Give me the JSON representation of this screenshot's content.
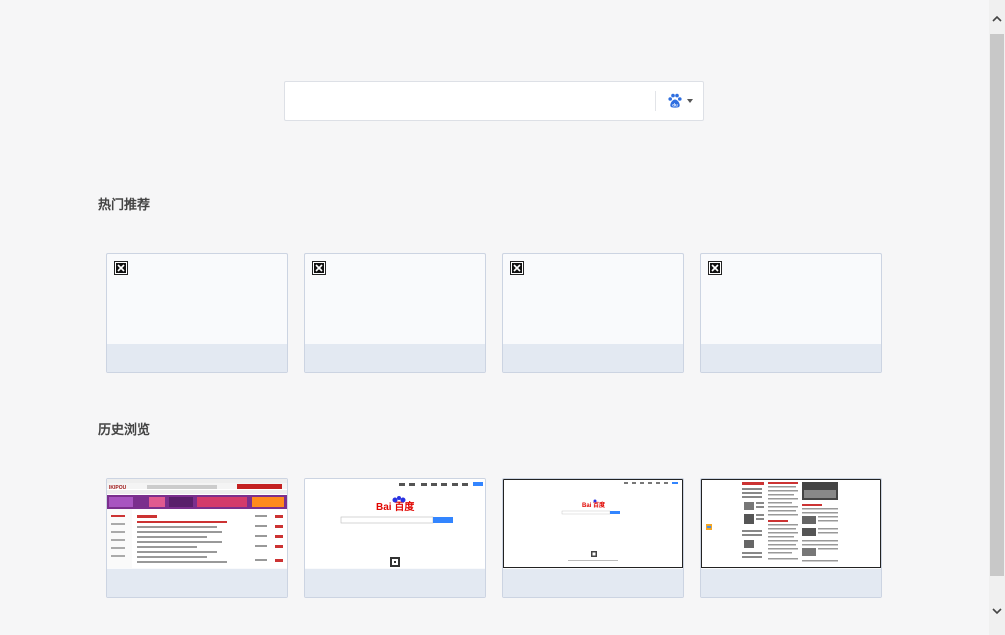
{
  "search": {
    "placeholder": "",
    "value": "",
    "engine_icon": "baidu-paw-icon"
  },
  "hot_section": {
    "title": "热门推荐",
    "tiles": [
      {
        "label": "",
        "thumbnail": "broken-image-icon"
      },
      {
        "label": "",
        "thumbnail": "broken-image-icon"
      },
      {
        "label": "",
        "thumbnail": "broken-image-icon"
      },
      {
        "label": "",
        "thumbnail": "broken-image-icon"
      }
    ]
  },
  "history_section": {
    "title": "历史浏览",
    "tiles": [
      {
        "label": "",
        "thumbnail": "shopping-site-screenshot",
        "logo_text": "IKIPOU"
      },
      {
        "label": "",
        "thumbnail": "baidu-homepage-screenshot",
        "logo_text": "Bai 百度"
      },
      {
        "label": "",
        "thumbnail": "baidu-homepage-small-screenshot",
        "logo_text": "Bai 百度"
      },
      {
        "label": "",
        "thumbnail": "news-portal-screenshot",
        "logo_text": ""
      }
    ]
  },
  "colors": {
    "background": "#f6f6f7",
    "tile_border": "#ccd4e2",
    "tile_footer": "#e3e9f2",
    "baidu_blue": "#2932e1",
    "baidu_red": "#e10601"
  }
}
